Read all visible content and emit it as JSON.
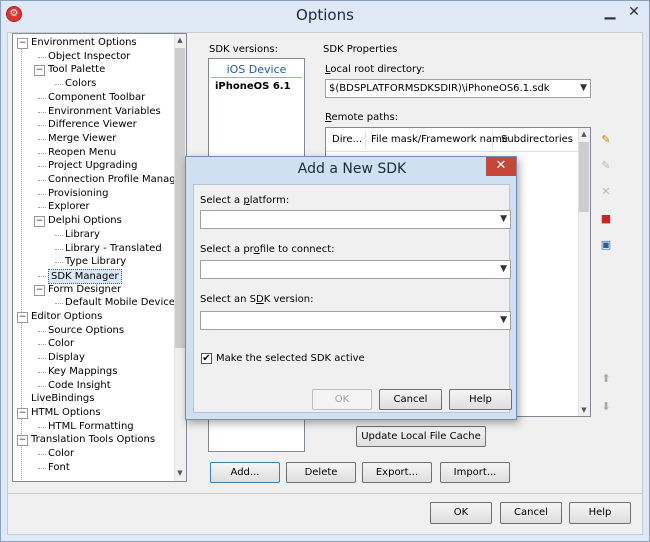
{
  "window": {
    "title": "Options",
    "app_icon": "options-app-icon",
    "minimize_icon": "minimize-icon",
    "close_icon": "close-icon"
  },
  "tree": {
    "items": [
      {
        "label": "Environment Options",
        "level": 0,
        "expander": "−"
      },
      {
        "label": "Object Inspector",
        "level": 1
      },
      {
        "label": "Tool Palette",
        "level": 1,
        "expander": "−"
      },
      {
        "label": "Colors",
        "level": 2
      },
      {
        "label": "Component Toolbar",
        "level": 1
      },
      {
        "label": "Environment Variables",
        "level": 1
      },
      {
        "label": "Difference Viewer",
        "level": 1
      },
      {
        "label": "Merge Viewer",
        "level": 1
      },
      {
        "label": "Reopen Menu",
        "level": 1
      },
      {
        "label": "Project Upgrading",
        "level": 1
      },
      {
        "label": "Connection Profile Manager",
        "level": 1
      },
      {
        "label": "Provisioning",
        "level": 1
      },
      {
        "label": "Explorer",
        "level": 1
      },
      {
        "label": "Delphi Options",
        "level": 1,
        "expander": "−"
      },
      {
        "label": "Library",
        "level": 2
      },
      {
        "label": "Library - Translated",
        "level": 2
      },
      {
        "label": "Type Library",
        "level": 2
      },
      {
        "label": "SDK Manager",
        "level": 1,
        "selected": true
      },
      {
        "label": "Form Designer",
        "level": 1,
        "expander": "−"
      },
      {
        "label": "Default Mobile Device",
        "level": 2
      },
      {
        "label": "Editor Options",
        "level": 0,
        "expander": "−"
      },
      {
        "label": "Source Options",
        "level": 1
      },
      {
        "label": "Color",
        "level": 1
      },
      {
        "label": "Display",
        "level": 1
      },
      {
        "label": "Key Mappings",
        "level": 1
      },
      {
        "label": "Code Insight",
        "level": 1
      },
      {
        "label": "LiveBindings",
        "level": 0
      },
      {
        "label": "HTML Options",
        "level": 0,
        "expander": "−"
      },
      {
        "label": "HTML Formatting",
        "level": 1
      },
      {
        "label": "Translation Tools Options",
        "level": 0,
        "expander": "−"
      },
      {
        "label": "Color",
        "level": 1
      },
      {
        "label": "Font",
        "level": 1
      }
    ]
  },
  "sdk_versions": {
    "label": "SDK versions:",
    "items": [
      {
        "label": "iOS Device",
        "kind": "group"
      },
      {
        "label": "iPhoneOS 6.1",
        "kind": "item"
      }
    ]
  },
  "sdk_properties": {
    "label": "SDK Properties",
    "local_root_label": "Local root directory:",
    "local_root_value": "$(BDSPLATFORMSDKSDIR)\\iPhoneOS6.1.sdk",
    "remote_paths_label": "Remote paths:",
    "columns": [
      "Dire...",
      "File mask/Framework name",
      "Subdirectories"
    ],
    "update_cache_label": "Update Local File Cache"
  },
  "side_icons": [
    {
      "name": "add-path-icon",
      "glyph": "✎"
    },
    {
      "name": "edit-path-icon",
      "glyph": "✎"
    },
    {
      "name": "delete-path-icon",
      "glyph": "✕"
    },
    {
      "name": "stop-icon",
      "glyph": "■"
    },
    {
      "name": "save-icon",
      "glyph": "▣"
    },
    {
      "name": "move-up-icon",
      "glyph": "⬆"
    },
    {
      "name": "move-down-icon",
      "glyph": "⬇"
    }
  ],
  "bottom_buttons": {
    "add": "Add...",
    "delete": "Delete",
    "export": "Export...",
    "import": "Import..."
  },
  "footer": {
    "ok": "OK",
    "cancel": "Cancel",
    "help": "Help"
  },
  "dialog": {
    "title": "Add a New SDK",
    "close_glyph": "✕",
    "platform_label": "Select a platform:",
    "platform_value": "",
    "profile_label": "Select a profile to connect:",
    "profile_value": "",
    "sdk_version_label": "Select an SDK version:",
    "sdk_version_value": "",
    "make_active_label": "Make the selected SDK active",
    "make_active_checked": "✔",
    "ok": "OK",
    "cancel": "Cancel",
    "help": "Help"
  },
  "colors": {
    "window_bg": "#dfe8f5",
    "dialog_frame": "#cfe0f3",
    "close_red": "#c7463a",
    "selection": "#dbe8f7"
  }
}
